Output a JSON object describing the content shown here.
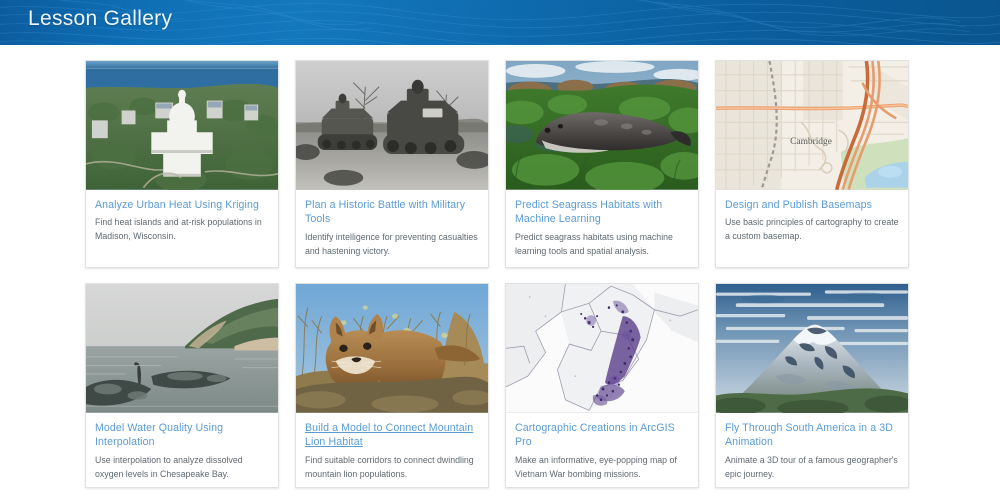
{
  "header": {
    "title": "Lesson Gallery",
    "background_color": "#0f6fb5",
    "title_color": "#eef5fb",
    "pattern": "topographic-contours"
  },
  "theme": {
    "page_background": "#ffffff",
    "card_background": "#ffffff",
    "card_border": "#e2e2e2",
    "link_color": "#5a9bd4",
    "description_color": "#5f6a72"
  },
  "gallery": {
    "rows": [
      {
        "cards": [
          {
            "title": "Analyze Urban Heat Using Kriging",
            "description": "Find heat islands and at-risk populations in Madison, Wisconsin.",
            "thumb": "aerial-city-capitol-lake",
            "hovered": false
          },
          {
            "title": "Plan a Historic Battle with Military Tools",
            "description": "Identify intelligence for preventing casualties and hastening victory.",
            "thumb": "bw-historic-tanks",
            "hovered": false
          },
          {
            "title": "Predict Seagrass Habitats with Machine Learning",
            "description": "Predict seagrass habitats using machine learning tools and spatial analysis.",
            "thumb": "seal-on-seagrass",
            "hovered": false
          },
          {
            "title": "Design and Publish Basemaps",
            "description": "Use basic principles of cartography to create a custom basemap.",
            "thumb": "street-basemap-cambridge",
            "hovered": false
          }
        ]
      },
      {
        "cards": [
          {
            "title": "Model Water Quality Using Interpolation",
            "description": "Use interpolation to analyze dissolved oxygen levels in Chesapeake Bay.",
            "thumb": "chesapeake-bay-shoreline",
            "hovered": false
          },
          {
            "title": "Build a Model to Connect Mountain Lion Habitat",
            "description": "Find suitable corridors to connect dwindling mountain lion populations.",
            "thumb": "mountain-lion",
            "hovered": true
          },
          {
            "title": "Cartographic Creations in ArcGIS Pro",
            "description": "Make an informative, eye-popping map of Vietnam War bombing missions.",
            "thumb": "vietnam-bombing-density-map",
            "hovered": false
          },
          {
            "title": "Fly Through South America in a 3D Animation",
            "description": "Animate a 3D tour of a famous geographer's epic journey.",
            "thumb": "snowcapped-volcano",
            "hovered": false
          }
        ]
      }
    ]
  },
  "map_labels": {
    "basemap_place": "Cambridge"
  }
}
